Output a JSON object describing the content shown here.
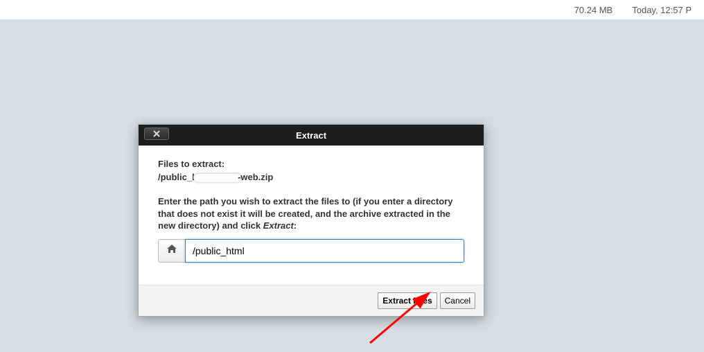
{
  "topbar": {
    "size": "70.24 MB",
    "date": "Today, 12:57 P"
  },
  "dialog": {
    "title": "Extract",
    "files_label": "Files to extract:",
    "filename_prefix": "/public_h",
    "filename_suffix": "-web.zip",
    "instruction_part1": "Enter the path you wish to extract the files to (if you enter a directory that does not exist it will be created, and the archive extracted in the new directory) and click ",
    "instruction_em": "Extract",
    "instruction_part2": ":",
    "path_value": "/public_html",
    "primary_btn": "Extract Files",
    "cancel_btn": "Cancel"
  },
  "icons": {
    "close": "close-icon",
    "home": "home-icon"
  },
  "arrow_color": "#ff0000"
}
